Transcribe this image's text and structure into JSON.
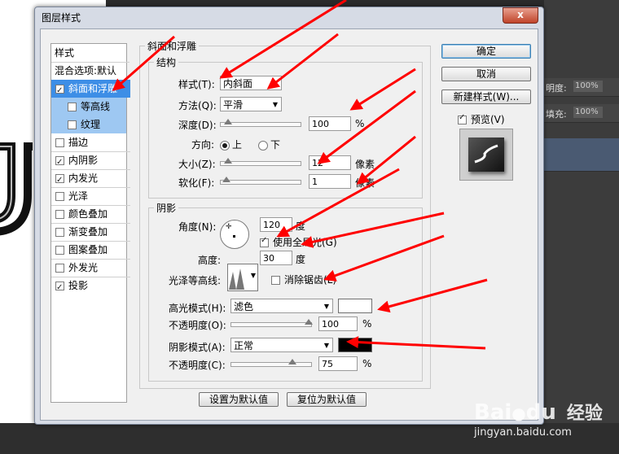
{
  "dialog": {
    "title": "图层样式",
    "close_label": "x"
  },
  "left_panel": {
    "header": "样式",
    "blend_options": "混合选项:默认",
    "items": [
      {
        "label": "斜面和浮雕",
        "checked": true
      },
      {
        "label": "等高线",
        "checked": false
      },
      {
        "label": "纹理",
        "checked": false
      },
      {
        "label": "描边",
        "checked": false
      },
      {
        "label": "内阴影",
        "checked": true
      },
      {
        "label": "内发光",
        "checked": true
      },
      {
        "label": "光泽",
        "checked": false
      },
      {
        "label": "颜色叠加",
        "checked": false
      },
      {
        "label": "渐变叠加",
        "checked": false
      },
      {
        "label": "图案叠加",
        "checked": false
      },
      {
        "label": "外发光",
        "checked": false
      },
      {
        "label": "投影",
        "checked": true
      }
    ]
  },
  "bevel": {
    "group_title": "斜面和浮雕",
    "structure_title": "结构",
    "style_label": "样式(T):",
    "style_value": "内斜面",
    "method_label": "方法(Q):",
    "method_value": "平滑",
    "depth_label": "深度(D):",
    "depth_value": "100",
    "depth_unit": "%",
    "direction_label": "方向:",
    "direction_up": "上",
    "direction_down": "下",
    "size_label": "大小(Z):",
    "size_value": "12",
    "size_unit": "像素",
    "soften_label": "软化(F):",
    "soften_value": "1",
    "soften_unit": "像素"
  },
  "shading": {
    "group_title": "阴影",
    "angle_label": "角度(N):",
    "angle_value": "120",
    "angle_unit": "度",
    "global_light_label": "使用全局光(G)",
    "altitude_label": "高度:",
    "altitude_value": "30",
    "altitude_unit": "度",
    "gloss_contour_label": "光泽等高线:",
    "anti_alias_label": "消除锯齿(L)",
    "highlight_mode_label": "高光模式(H):",
    "highlight_mode_value": "滤色",
    "highlight_opacity_label": "不透明度(O):",
    "highlight_opacity_value": "100",
    "highlight_opacity_unit": "%",
    "shadow_mode_label": "阴影模式(A):",
    "shadow_mode_value": "正常",
    "shadow_opacity_label": "不透明度(C):",
    "shadow_opacity_value": "75",
    "shadow_opacity_unit": "%",
    "highlight_color": "#ffffff",
    "shadow_color": "#000000"
  },
  "footer": {
    "make_default": "设置为默认值",
    "reset_default": "复位为默认值"
  },
  "side_buttons": {
    "ok": "确定",
    "cancel": "取消",
    "new_style": "新建样式(W)...",
    "preview_label": "预览(V)"
  },
  "background": {
    "opacity_label": "明度:",
    "opacity_value": "100%",
    "fill_label": "填充:",
    "fill_value": "100%"
  },
  "watermark": {
    "brand": "Bai",
    "brand2": "du",
    "site_name": "经验",
    "url": "jingyan.baidu.com"
  },
  "colors": {
    "accent": "#3d8ee6",
    "arrow": "#ff0000"
  }
}
